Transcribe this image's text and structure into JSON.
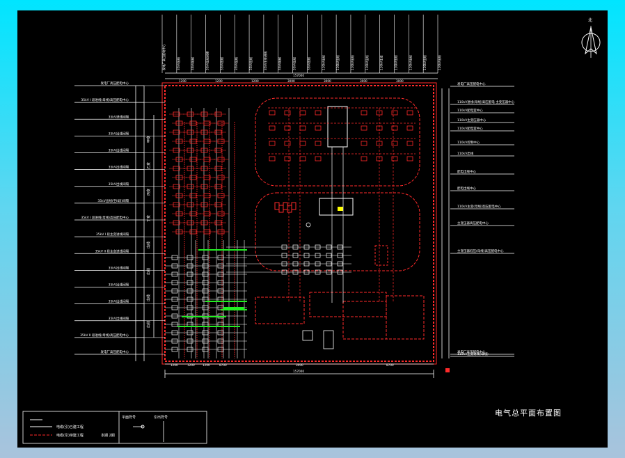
{
  "drawing": {
    "title": "电气总平面布置图",
    "north_label": "北",
    "colors": {
      "background": "#000000",
      "frame_outer": "#00e5ff",
      "line_white": "#ffffff",
      "line_red": "#ff2a2a",
      "line_green": "#22ee22",
      "line_yellow": "#ffff00"
    },
    "left_labels": [
      "发电厂​高压配电中心",
      "35kV I 段进线(母线)高压配电中心",
      "35kV进线间隔",
      "35kV出线间隔",
      "35kV出线间隔",
      "35kV出线间隔",
      "35kV出线间隔",
      "35kV出线(至II段)间隔",
      "35kV I 段进线(母线)高压配电中心",
      "35kV I 段主变进线间隔",
      "35kV II 段主变进线间隔",
      "35kV出线间隔",
      "35kV出线间隔",
      "35kV出线间隔",
      "35kV出线间隔",
      "35kV II 段进线(母线)高压配电中心",
      "发电厂​高压配电中心"
    ],
    "right_labels": [
      "发电厂​高压配电中心",
      "110kV进线(母线)高压配电 主变压器中心",
      "110kV配电室中心",
      "110kV主变压器中心",
      "110kV配电室中心",
      "110kV控制中心",
      "110kV出线",
      "配电出线中心",
      "配电出线中心",
      "110kV主变(母线)高压配电中心",
      "主变压器高压配电中心",
      "主变压器低压(母线)高压配电中心",
      "110kV主变进线(母线)",
      "发电厂​高压配电中心"
    ],
    "left_side_tags": [
      "甲变",
      "乙变",
      "丙变",
      "丁变",
      "出线",
      "出线",
      "出线",
      "出线"
    ],
    "top_column_labels": [
      "发电厂高压配电中心",
      "35kV出线",
      "35kV出线",
      "35kV出线间隔",
      "35kV出线",
      "35kV出线",
      "35kV出线",
      "35kV主变进线",
      "35kV出线",
      "35kV出线",
      "35kV出线",
      "110kV出线",
      "110kV出线",
      "110kV出线",
      "110kV出线",
      "110kV主变",
      "110kV出线",
      "110kV出线",
      "110kV出线",
      "110kV出线"
    ],
    "top_dimensions": [
      "1200",
      "1200",
      "1200",
      "3000",
      "3000",
      "3000",
      "3000"
    ],
    "top_total_dimension": "157000",
    "bottom_dimensions": [
      "1200",
      "1200",
      "1200",
      "8700",
      "3000",
      "8700"
    ],
    "bottom_total_dimension": "157000",
    "legend": {
      "items": [
        {
          "label": "电缆(引)已建工程"
        },
        {
          "label": "电缆(引)待建工程"
        }
      ],
      "notes": [
        "本期 2期",
        "设计"
      ],
      "symbols": [
        "平面符号",
        "引出符号"
      ]
    },
    "building_tags": [
      "主控楼",
      "配电室",
      "设备"
    ]
  }
}
